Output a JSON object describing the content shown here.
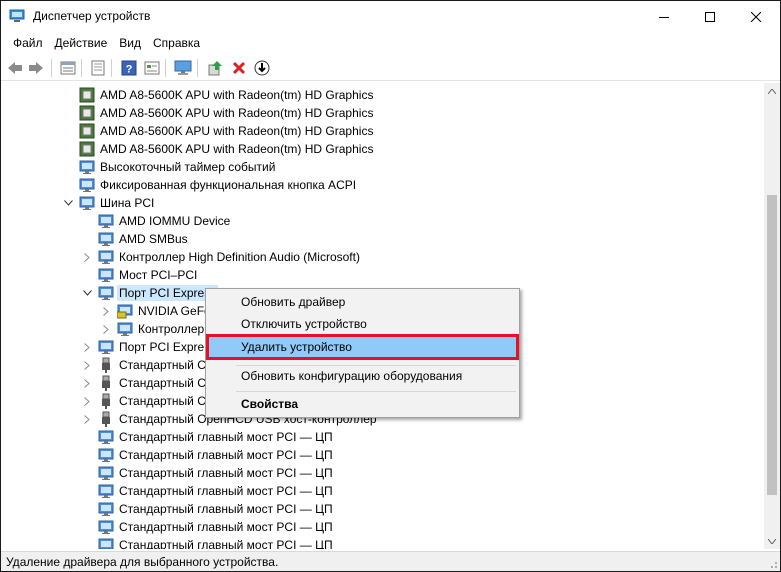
{
  "window": {
    "title": "Диспетчер устройств"
  },
  "menu": [
    "Файл",
    "Действие",
    "Вид",
    "Справка"
  ],
  "toolbar": [
    "back-icon",
    "forward-icon",
    "properties-icon",
    "scan-icon",
    "help-icon",
    "view-icon",
    "monitor-icon",
    "update-driver-icon",
    "uninstall-icon",
    "download-icon"
  ],
  "tree": [
    {
      "label": "AMD A8-5600K APU with Radeon(tm) HD Graphics",
      "icon": "cpu-icon",
      "indent": 1,
      "exp": ""
    },
    {
      "label": "AMD A8-5600K APU with Radeon(tm) HD Graphics",
      "icon": "cpu-icon",
      "indent": 1,
      "exp": ""
    },
    {
      "label": "AMD A8-5600K APU with Radeon(tm) HD Graphics",
      "icon": "cpu-icon",
      "indent": 1,
      "exp": ""
    },
    {
      "label": "AMD A8-5600K APU with Radeon(tm) HD Graphics",
      "icon": "cpu-icon",
      "indent": 1,
      "exp": ""
    },
    {
      "label": "Высокоточный таймер событий",
      "icon": "system-device-icon",
      "indent": 1,
      "exp": ""
    },
    {
      "label": "Фиксированная функциональная кнопка ACPI",
      "icon": "system-device-icon",
      "indent": 1,
      "exp": ""
    },
    {
      "label": "Шина PCI",
      "icon": "system-device-icon",
      "indent": 1,
      "exp": "open"
    },
    {
      "label": "AMD IOMMU Device",
      "icon": "system-device-icon",
      "indent": 2,
      "exp": ""
    },
    {
      "label": "AMD SMBus",
      "icon": "system-device-icon",
      "indent": 2,
      "exp": ""
    },
    {
      "label": "Контроллер High Definition Audio (Microsoft)",
      "icon": "system-device-icon",
      "indent": 2,
      "exp": "closed"
    },
    {
      "label": "Мост PCI–PCI",
      "icon": "system-device-icon",
      "indent": 2,
      "exp": ""
    },
    {
      "label": "Порт PCI Express",
      "icon": "system-device-icon",
      "indent": 2,
      "exp": "open",
      "selected": true
    },
    {
      "label": "NVIDIA GeFo",
      "icon": "display-adapter-icon",
      "indent": 3,
      "exp": "closed"
    },
    {
      "label": "Контроллер",
      "icon": "system-device-icon",
      "indent": 3,
      "exp": "closed"
    },
    {
      "label": "Порт PCI Expre",
      "icon": "system-device-icon",
      "indent": 2,
      "exp": "closed"
    },
    {
      "label": "Стандартный С",
      "icon": "usb-icon",
      "indent": 2,
      "exp": "closed"
    },
    {
      "label": "Стандартный С",
      "icon": "usb-icon",
      "indent": 2,
      "exp": "closed"
    },
    {
      "label": "Стандартный С",
      "icon": "usb-icon",
      "indent": 2,
      "exp": "closed"
    },
    {
      "label": "Стандартный OpenHCD USB хост-контроллер",
      "icon": "usb-icon",
      "indent": 2,
      "exp": "closed"
    },
    {
      "label": "Стандартный главный мост PCI — ЦП",
      "icon": "system-device-icon",
      "indent": 2,
      "exp": ""
    },
    {
      "label": "Стандартный главный мост PCI — ЦП",
      "icon": "system-device-icon",
      "indent": 2,
      "exp": ""
    },
    {
      "label": "Стандартный главный мост PCI — ЦП",
      "icon": "system-device-icon",
      "indent": 2,
      "exp": ""
    },
    {
      "label": "Стандартный главный мост PCI — ЦП",
      "icon": "system-device-icon",
      "indent": 2,
      "exp": ""
    },
    {
      "label": "Стандартный главный мост PCI — ЦП",
      "icon": "system-device-icon",
      "indent": 2,
      "exp": ""
    },
    {
      "label": "Стандартный главный мост PCI — ЦП",
      "icon": "system-device-icon",
      "indent": 2,
      "exp": ""
    },
    {
      "label": "Стандартный главный мост PCI — ЦП",
      "icon": "system-device-icon",
      "indent": 2,
      "exp": ""
    },
    {
      "label": "Стандартный главный мост PCI — ЦП",
      "icon": "system-device-icon",
      "indent": 2,
      "exp": ""
    }
  ],
  "context_menu": {
    "items": [
      {
        "label": "Обновить драйвер"
      },
      {
        "label": "Отключить устройство"
      },
      {
        "label": "Удалить устройство",
        "highlighted": true
      },
      {
        "label": "Обновить конфигурацию оборудования"
      },
      {
        "label": "Свойства",
        "bold": true
      }
    ]
  },
  "status": {
    "text": "Удаление драйвера для выбранного устройства."
  },
  "colors": {
    "highlight": "#91c9f7",
    "annotation_box": "#e81123",
    "selection": "#cce8ff"
  }
}
